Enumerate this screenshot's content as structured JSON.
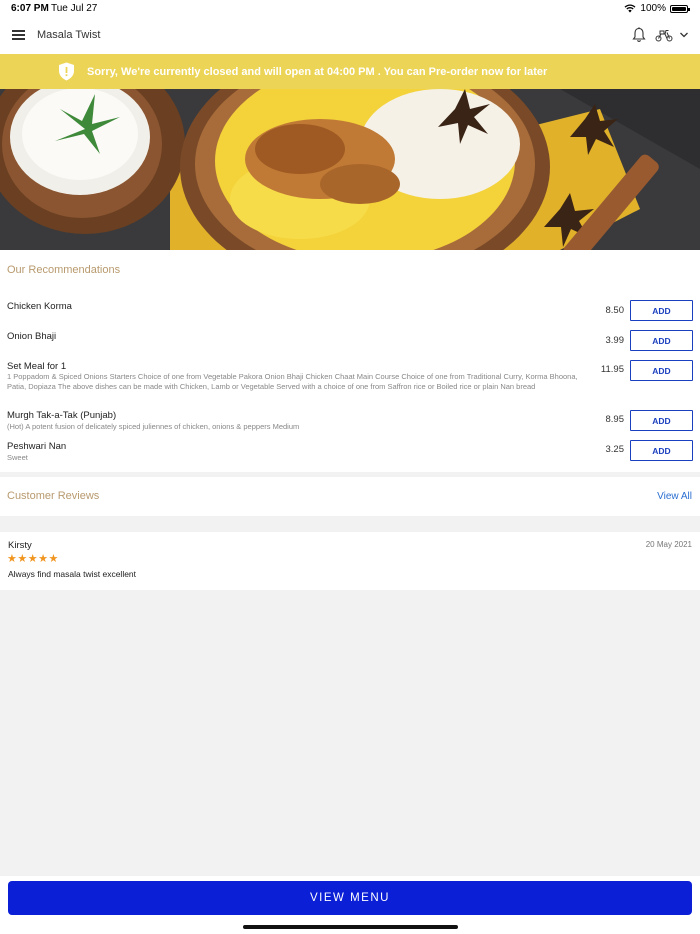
{
  "status_bar": {
    "time": "6:07 PM",
    "date": "Tue Jul 27",
    "battery": "100%"
  },
  "header": {
    "title": "Masala Twist",
    "icons": [
      "menu-icon",
      "bell-icon",
      "scooter-icon",
      "chevron-down-icon"
    ]
  },
  "banner": {
    "message": "Sorry, We're currently closed and will open at 04:00 PM . You can Pre-order now for later",
    "color": "#ecd456"
  },
  "recommendations": {
    "title": "Our Recommendations",
    "add_label": "ADD",
    "items": [
      {
        "name": "Chicken Korma",
        "desc": "",
        "price": "8.50"
      },
      {
        "name": "Onion Bhaji",
        "desc": "",
        "price": "3.99"
      },
      {
        "name": "Set Meal for 1",
        "desc": "1 Poppadom & Spiced Onions   Starters  Choice of one from  Vegetable Pakora  Onion Bhaji  Chicken Chaat   Main Course  Choice of one from  Traditional Curry,  Korma  Bhoona, Patia, Dopiaza   The above dishes can be made with  Chicken, Lamb or Vegetable  Served with a choice of one from Saffron rice  or Boiled rice or plain Nan bread",
        "price": "11.95"
      },
      {
        "name": "Murgh Tak-a-Tak (Punjab)",
        "desc": "(Hot) A potent fusion of delicately spiced juliennes of chicken, onions & peppers    Medium",
        "price": "8.95"
      },
      {
        "name": "Peshwari Nan",
        "desc": "Sweet",
        "price": "3.25"
      }
    ]
  },
  "reviews": {
    "title": "Customer Reviews",
    "view_all": "View All",
    "items": [
      {
        "author": "Kirsty",
        "date": "20 May 2021",
        "stars": "★★★★★",
        "rating": 5,
        "text": "Always find masala twist excellent"
      }
    ]
  },
  "footer": {
    "button": "VIEW MENU",
    "color": "#0a1fd6"
  }
}
